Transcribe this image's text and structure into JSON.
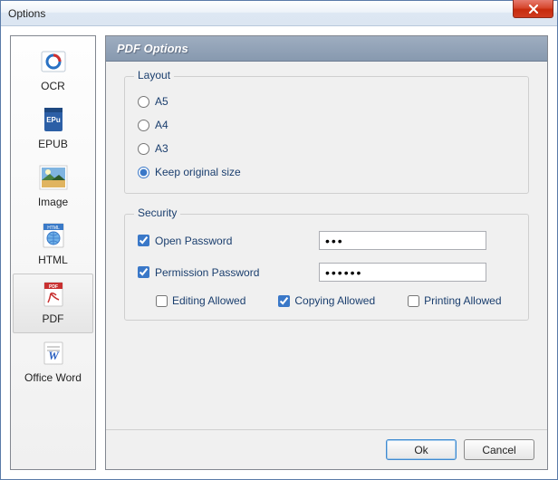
{
  "window": {
    "title": "Options"
  },
  "sidebar": {
    "items": [
      {
        "label": "OCR"
      },
      {
        "label": "EPUB"
      },
      {
        "label": "Image"
      },
      {
        "label": "HTML"
      },
      {
        "label": "PDF"
      },
      {
        "label": "Office Word"
      }
    ]
  },
  "main": {
    "title": "PDF Options",
    "layout": {
      "title": "Layout",
      "options": {
        "a5": "A5",
        "a4": "A4",
        "a3": "A3",
        "keep": "Keep original size"
      },
      "selected": "keep"
    },
    "security": {
      "title": "Security",
      "open_password_label": "Open Password",
      "open_password_checked": true,
      "open_password_value": "•••",
      "permission_password_label": "Permission Password",
      "permission_password_checked": true,
      "permission_password_value": "••••••",
      "editing_label": "Editing Allowed",
      "editing_checked": false,
      "copying_label": "Copying Allowed",
      "copying_checked": true,
      "printing_label": "Printing Allowed",
      "printing_checked": false
    }
  },
  "footer": {
    "ok_label": "Ok",
    "cancel_label": "Cancel"
  }
}
